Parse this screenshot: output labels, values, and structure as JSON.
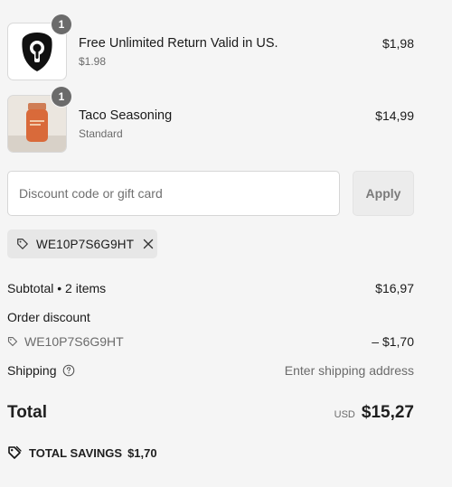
{
  "items": [
    {
      "title": "Free Unlimited Return Valid in US.",
      "subtitle": "$1.98",
      "price": "$1,98",
      "quantity": "1",
      "icon": "shield-keyhole-icon"
    },
    {
      "title": "Taco Seasoning",
      "subtitle": "Standard",
      "price": "$14,99",
      "quantity": "1",
      "icon": "spice-bottle-image"
    }
  ],
  "discount": {
    "placeholder": "Discount code or gift card",
    "apply_label": "Apply",
    "applied_code": "WE10P7S6G9HT"
  },
  "summary": {
    "subtotal_label": "Subtotal • 2 items",
    "subtotal_value": "$16,97",
    "order_discount_label": "Order discount",
    "order_discount_code": "WE10P7S6G9HT",
    "order_discount_value": "– $1,70",
    "shipping_label": "Shipping",
    "shipping_value": "Enter shipping address"
  },
  "total": {
    "label": "Total",
    "currency": "USD",
    "amount": "$15,27"
  },
  "savings": {
    "label": "TOTAL SAVINGS",
    "amount": "$1,70"
  },
  "colors": {
    "background": "#f5f5f5",
    "badge": "#6b6b6b",
    "bottle": "#d96a3a"
  }
}
